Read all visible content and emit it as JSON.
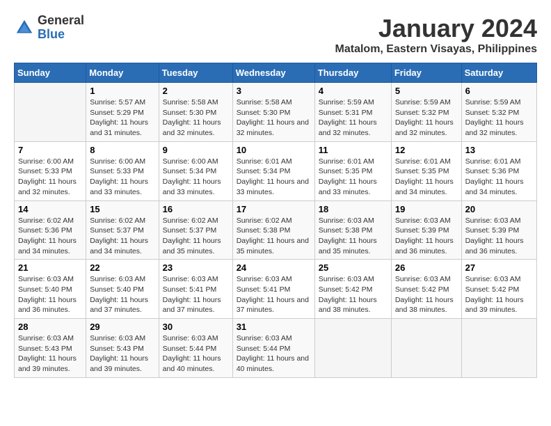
{
  "logo": {
    "general": "General",
    "blue": "Blue"
  },
  "header": {
    "title": "January 2024",
    "subtitle": "Matalom, Eastern Visayas, Philippines"
  },
  "days_of_week": [
    "Sunday",
    "Monday",
    "Tuesday",
    "Wednesday",
    "Thursday",
    "Friday",
    "Saturday"
  ],
  "weeks": [
    [
      {
        "day": "",
        "info": ""
      },
      {
        "day": "1",
        "info": "Sunrise: 5:57 AM\nSunset: 5:29 PM\nDaylight: 11 hours and 31 minutes."
      },
      {
        "day": "2",
        "info": "Sunrise: 5:58 AM\nSunset: 5:30 PM\nDaylight: 11 hours and 32 minutes."
      },
      {
        "day": "3",
        "info": "Sunrise: 5:58 AM\nSunset: 5:30 PM\nDaylight: 11 hours and 32 minutes."
      },
      {
        "day": "4",
        "info": "Sunrise: 5:59 AM\nSunset: 5:31 PM\nDaylight: 11 hours and 32 minutes."
      },
      {
        "day": "5",
        "info": "Sunrise: 5:59 AM\nSunset: 5:32 PM\nDaylight: 11 hours and 32 minutes."
      },
      {
        "day": "6",
        "info": "Sunrise: 5:59 AM\nSunset: 5:32 PM\nDaylight: 11 hours and 32 minutes."
      }
    ],
    [
      {
        "day": "7",
        "info": "Sunrise: 6:00 AM\nSunset: 5:33 PM\nDaylight: 11 hours and 32 minutes."
      },
      {
        "day": "8",
        "info": "Sunrise: 6:00 AM\nSunset: 5:33 PM\nDaylight: 11 hours and 33 minutes."
      },
      {
        "day": "9",
        "info": "Sunrise: 6:00 AM\nSunset: 5:34 PM\nDaylight: 11 hours and 33 minutes."
      },
      {
        "day": "10",
        "info": "Sunrise: 6:01 AM\nSunset: 5:34 PM\nDaylight: 11 hours and 33 minutes."
      },
      {
        "day": "11",
        "info": "Sunrise: 6:01 AM\nSunset: 5:35 PM\nDaylight: 11 hours and 33 minutes."
      },
      {
        "day": "12",
        "info": "Sunrise: 6:01 AM\nSunset: 5:35 PM\nDaylight: 11 hours and 34 minutes."
      },
      {
        "day": "13",
        "info": "Sunrise: 6:01 AM\nSunset: 5:36 PM\nDaylight: 11 hours and 34 minutes."
      }
    ],
    [
      {
        "day": "14",
        "info": "Sunrise: 6:02 AM\nSunset: 5:36 PM\nDaylight: 11 hours and 34 minutes."
      },
      {
        "day": "15",
        "info": "Sunrise: 6:02 AM\nSunset: 5:37 PM\nDaylight: 11 hours and 34 minutes."
      },
      {
        "day": "16",
        "info": "Sunrise: 6:02 AM\nSunset: 5:37 PM\nDaylight: 11 hours and 35 minutes."
      },
      {
        "day": "17",
        "info": "Sunrise: 6:02 AM\nSunset: 5:38 PM\nDaylight: 11 hours and 35 minutes."
      },
      {
        "day": "18",
        "info": "Sunrise: 6:03 AM\nSunset: 5:38 PM\nDaylight: 11 hours and 35 minutes."
      },
      {
        "day": "19",
        "info": "Sunrise: 6:03 AM\nSunset: 5:39 PM\nDaylight: 11 hours and 36 minutes."
      },
      {
        "day": "20",
        "info": "Sunrise: 6:03 AM\nSunset: 5:39 PM\nDaylight: 11 hours and 36 minutes."
      }
    ],
    [
      {
        "day": "21",
        "info": "Sunrise: 6:03 AM\nSunset: 5:40 PM\nDaylight: 11 hours and 36 minutes."
      },
      {
        "day": "22",
        "info": "Sunrise: 6:03 AM\nSunset: 5:40 PM\nDaylight: 11 hours and 37 minutes."
      },
      {
        "day": "23",
        "info": "Sunrise: 6:03 AM\nSunset: 5:41 PM\nDaylight: 11 hours and 37 minutes."
      },
      {
        "day": "24",
        "info": "Sunrise: 6:03 AM\nSunset: 5:41 PM\nDaylight: 11 hours and 37 minutes."
      },
      {
        "day": "25",
        "info": "Sunrise: 6:03 AM\nSunset: 5:42 PM\nDaylight: 11 hours and 38 minutes."
      },
      {
        "day": "26",
        "info": "Sunrise: 6:03 AM\nSunset: 5:42 PM\nDaylight: 11 hours and 38 minutes."
      },
      {
        "day": "27",
        "info": "Sunrise: 6:03 AM\nSunset: 5:42 PM\nDaylight: 11 hours and 39 minutes."
      }
    ],
    [
      {
        "day": "28",
        "info": "Sunrise: 6:03 AM\nSunset: 5:43 PM\nDaylight: 11 hours and 39 minutes."
      },
      {
        "day": "29",
        "info": "Sunrise: 6:03 AM\nSunset: 5:43 PM\nDaylight: 11 hours and 39 minutes."
      },
      {
        "day": "30",
        "info": "Sunrise: 6:03 AM\nSunset: 5:44 PM\nDaylight: 11 hours and 40 minutes."
      },
      {
        "day": "31",
        "info": "Sunrise: 6:03 AM\nSunset: 5:44 PM\nDaylight: 11 hours and 40 minutes."
      },
      {
        "day": "",
        "info": ""
      },
      {
        "day": "",
        "info": ""
      },
      {
        "day": "",
        "info": ""
      }
    ]
  ]
}
